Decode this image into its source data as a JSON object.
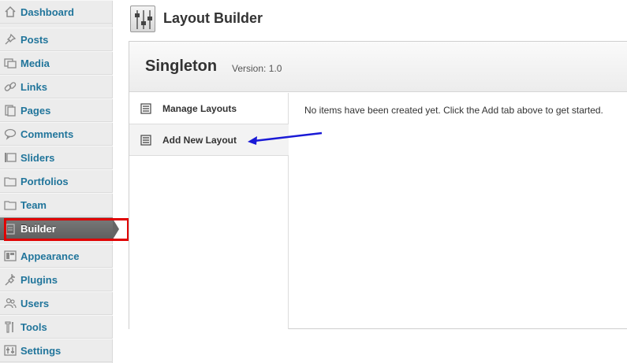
{
  "sidebar": {
    "items": [
      {
        "label": "Dashboard",
        "icon": "dashboard-icon"
      },
      {
        "label": "Posts",
        "icon": "pin-icon"
      },
      {
        "label": "Media",
        "icon": "media-icon"
      },
      {
        "label": "Links",
        "icon": "link-icon"
      },
      {
        "label": "Pages",
        "icon": "pages-icon"
      },
      {
        "label": "Comments",
        "icon": "comment-icon"
      },
      {
        "label": "Sliders",
        "icon": "sliders-icon"
      },
      {
        "label": "Portfolios",
        "icon": "folder-icon"
      },
      {
        "label": "Team",
        "icon": "folder-icon"
      },
      {
        "label": "Builder",
        "icon": "builder-icon",
        "current": true
      },
      {
        "label": "Appearance",
        "icon": "appearance-icon"
      },
      {
        "label": "Plugins",
        "icon": "plug-icon"
      },
      {
        "label": "Users",
        "icon": "users-icon"
      },
      {
        "label": "Tools",
        "icon": "tools-icon"
      },
      {
        "label": "Settings",
        "icon": "settings-icon"
      }
    ]
  },
  "header": {
    "title": "Layout Builder",
    "icon": "sliders-panel-icon"
  },
  "panel": {
    "title": "Singleton",
    "version": "Version: 1.0",
    "nav": [
      {
        "label": "Manage Layouts",
        "icon": "list-icon"
      },
      {
        "label": "Add New Layout",
        "icon": "list-icon"
      }
    ],
    "message": "No items have been created yet. Click the Add tab above to get started."
  },
  "colors": {
    "link": "#21759b",
    "highlight": "#e00000",
    "annotation_arrow": "#1a1ad6"
  }
}
